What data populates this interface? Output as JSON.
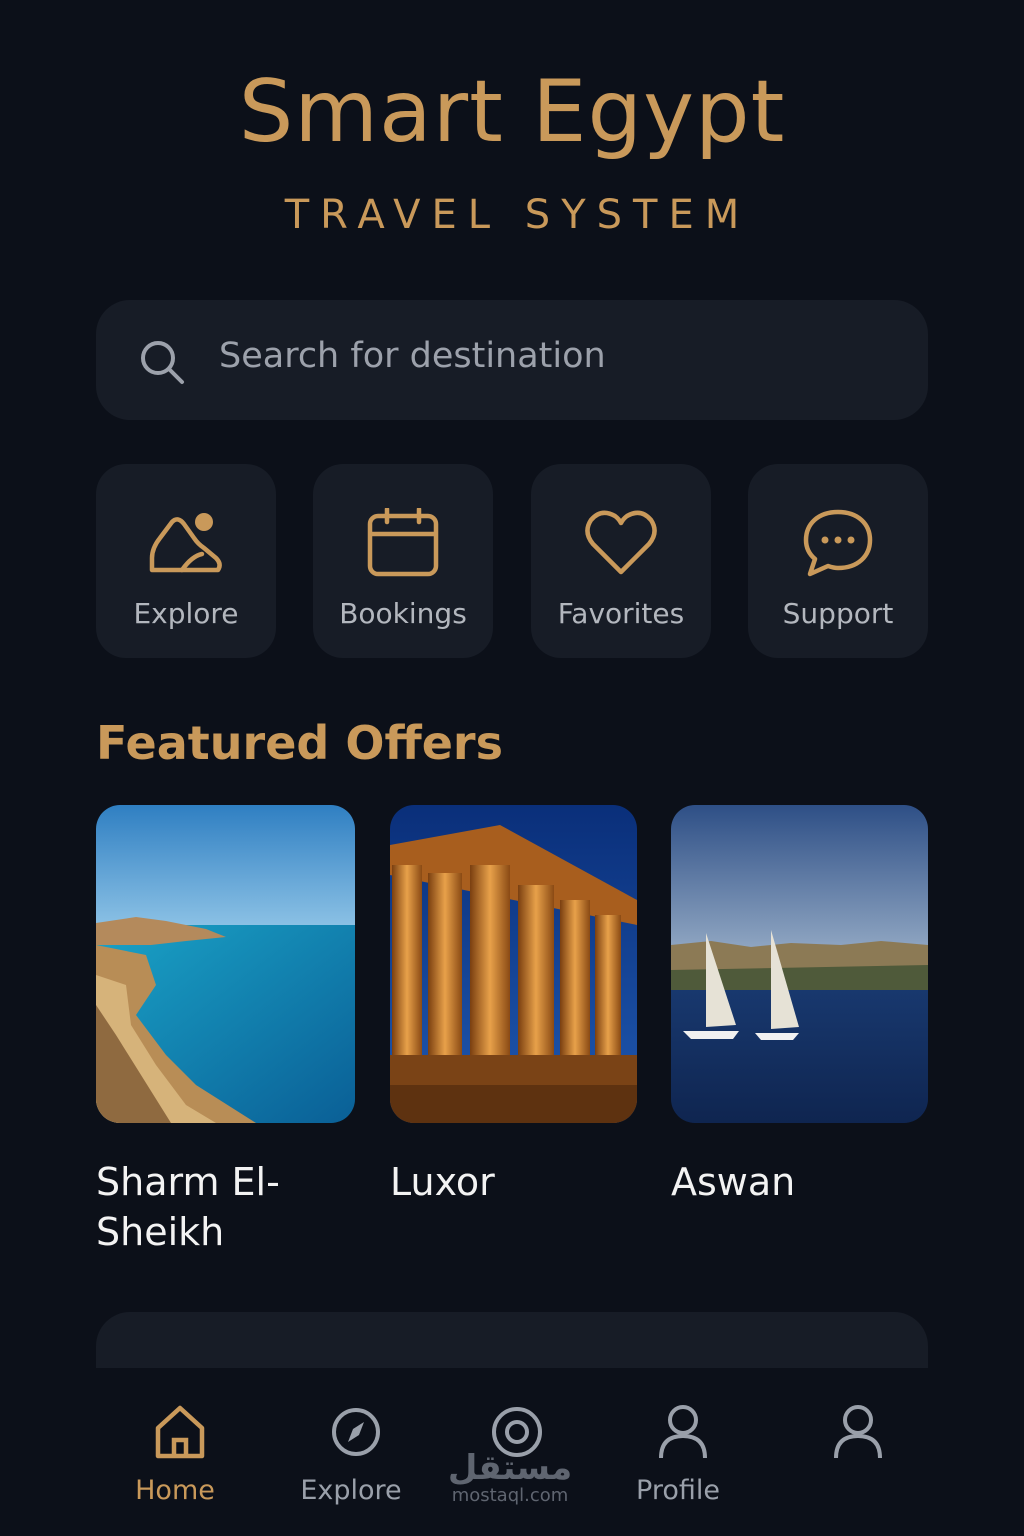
{
  "header": {
    "title": "Smart Egypt",
    "subtitle": "TRAVEL SYSTEM"
  },
  "search": {
    "placeholder": "Search for destination",
    "icon": "search-icon"
  },
  "quick_actions": [
    {
      "label": "Explore",
      "icon": "mountain-landscape-icon"
    },
    {
      "label": "Bookings",
      "icon": "calendar-icon"
    },
    {
      "label": "Favorites",
      "icon": "heart-icon"
    },
    {
      "label": "Support",
      "icon": "chat-bubble-icon"
    }
  ],
  "featured": {
    "title": "Featured Offers",
    "offers": [
      {
        "name": "Sharm El-Sheikh",
        "image": "beach-coastline-photo"
      },
      {
        "name": "Luxor",
        "image": "temple-columns-photo"
      },
      {
        "name": "Aswan",
        "image": "nile-sailboats-photo"
      }
    ]
  },
  "nav": {
    "items": [
      {
        "label": "Home",
        "icon": "home-icon",
        "active": true
      },
      {
        "label": "Explore",
        "icon": "compass-icon",
        "active": false
      },
      {
        "label": "",
        "icon": "target-icon",
        "active": false
      },
      {
        "label": "Profile",
        "icon": "user-icon",
        "active": false
      },
      {
        "label": "",
        "icon": "user-icon",
        "active": false
      }
    ]
  },
  "watermark": {
    "arabic": "مستقل",
    "latin": "mostaql.com"
  },
  "colors": {
    "background": "#0c1019",
    "card": "#171c26",
    "accent_gold": "#c9995a",
    "muted_text": "#9aa0aa",
    "primary_text": "#f3f3f3"
  }
}
